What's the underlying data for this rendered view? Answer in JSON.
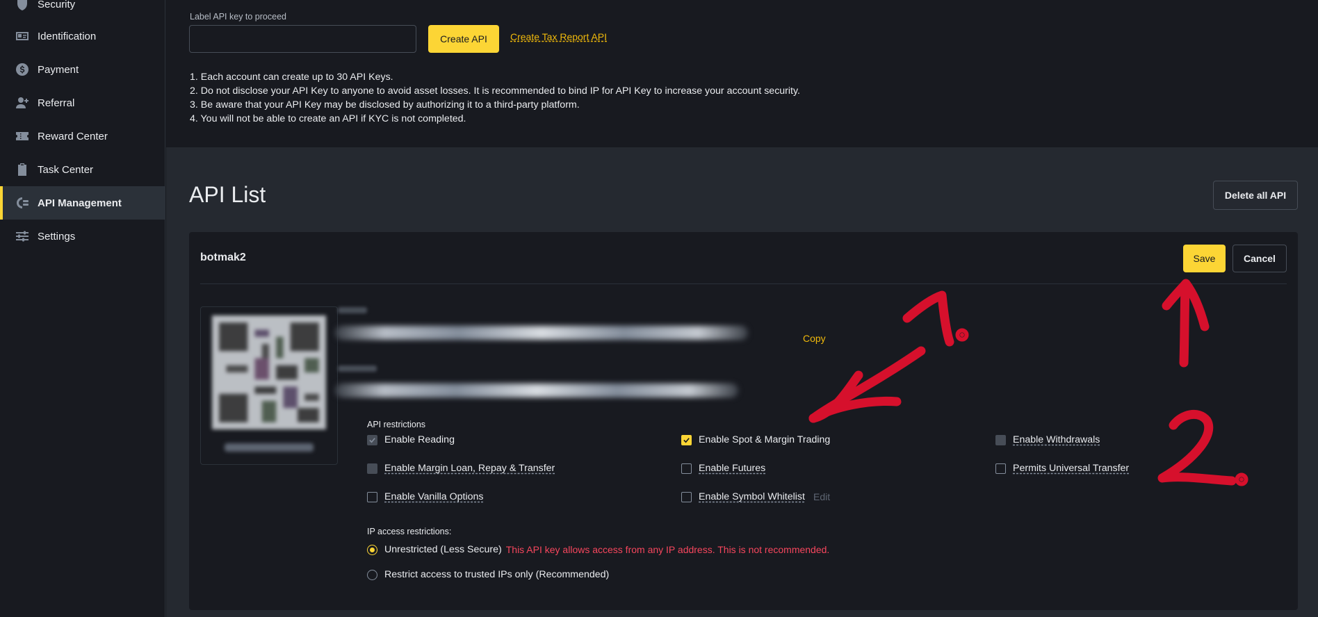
{
  "sidebar": {
    "items": [
      {
        "label": "Security",
        "icon": "shield-icon"
      },
      {
        "label": "Identification",
        "icon": "id-card-icon"
      },
      {
        "label": "Payment",
        "icon": "dollar-icon"
      },
      {
        "label": "Referral",
        "icon": "user-plus-icon"
      },
      {
        "label": "Reward Center",
        "icon": "ticket-icon"
      },
      {
        "label": "Task Center",
        "icon": "clipboard-icon"
      },
      {
        "label": "API Management",
        "icon": "api-icon",
        "active": true
      },
      {
        "label": "Settings",
        "icon": "sliders-icon"
      }
    ]
  },
  "create": {
    "field_label": "Label API key to proceed",
    "input_value": "",
    "create_button": "Create API",
    "tax_link": "Create Tax Report API",
    "notes": [
      "1. Each account can create up to 30 API Keys.",
      "2. Do not disclose your API Key to anyone to avoid asset losses. It is recommended to bind IP for API Key to increase your account security.",
      "3. Be aware that your API Key may be disclosed by authorizing it to a third-party platform.",
      "4. You will not be able to create an API if KYC is not completed."
    ]
  },
  "api_list": {
    "title": "API List",
    "delete_all_button": "Delete all API",
    "card": {
      "name": "botmak2",
      "save_button": "Save",
      "cancel_button": "Cancel",
      "copy_link": "Copy",
      "restrictions_label": "API restrictions",
      "restrictions": [
        {
          "label": "Enable Reading",
          "state": "disabled-checked",
          "dashed": false
        },
        {
          "label": "Enable Spot & Margin Trading",
          "state": "checked",
          "dashed": false
        },
        {
          "label": "Enable Withdrawals",
          "state": "disabled",
          "dashed": true
        },
        {
          "label": "Enable Margin Loan, Repay & Transfer",
          "state": "disabled",
          "dashed": true
        },
        {
          "label": "Enable Futures",
          "state": "unchecked",
          "dashed": true
        },
        {
          "label": "Permits Universal Transfer",
          "state": "unchecked",
          "dashed": true
        },
        {
          "label": "Enable Vanilla Options",
          "state": "unchecked",
          "dashed": true
        },
        {
          "label": "Enable Symbol Whitelist",
          "state": "unchecked",
          "dashed": true
        }
      ],
      "edit_link": "Edit",
      "ip_label": "IP access restrictions:",
      "ip_options": [
        {
          "label": "Unrestricted (Less Secure)",
          "selected": true
        },
        {
          "label": "Restrict access to trusted IPs only (Recommended)",
          "selected": false
        }
      ],
      "ip_warning": "This API key allows access from any IP address. This is not recommended."
    }
  },
  "colors": {
    "accent": "#fcd535",
    "annotation": "#d6102c",
    "warning": "#f6465d"
  }
}
